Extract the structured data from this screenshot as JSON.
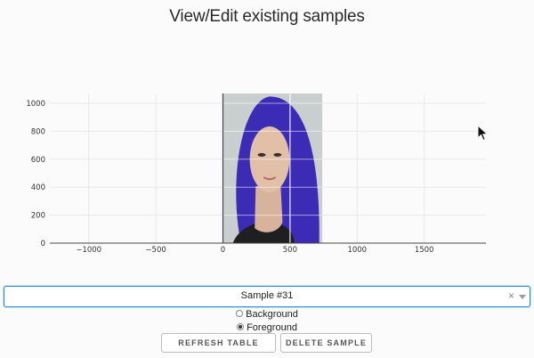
{
  "page": {
    "title": "View/Edit existing samples"
  },
  "plot": {
    "image_description_icon": "portrait-image",
    "axis_line_color": "#444444",
    "grid_color": "#e9e9ee",
    "image_x_range": [
      0,
      740
    ],
    "image_y_range": [
      0,
      1070
    ],
    "xlim": [
      -1290,
      1960
    ],
    "ylim": [
      0,
      1070
    ],
    "x_ticks": [
      -1000,
      -500,
      0,
      500,
      1000,
      1500
    ],
    "x_tick_labels": [
      "−1000",
      "−500",
      "0",
      "500",
      "1000",
      "1500"
    ],
    "y_ticks": [
      0,
      200,
      400,
      600,
      800,
      1000
    ],
    "y_tick_labels": [
      "0",
      "200",
      "400",
      "600",
      "800",
      "1000"
    ],
    "hair_color": "#3b2bb5"
  },
  "sample_select": {
    "value": "Sample #31",
    "clear_icon": "×"
  },
  "mode": {
    "options": [
      {
        "label": "Background",
        "selected": false
      },
      {
        "label": "Foreground",
        "selected": true
      }
    ]
  },
  "buttons": {
    "refresh": "REFRESH TABLE",
    "delete": "DELETE SAMPLE"
  }
}
